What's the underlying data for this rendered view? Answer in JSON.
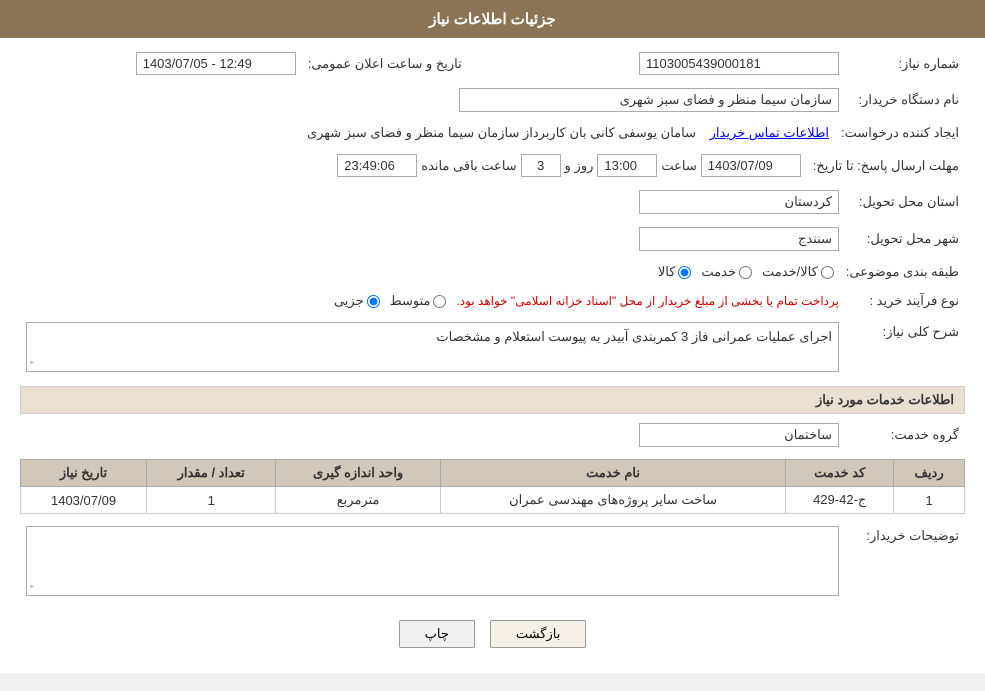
{
  "header": {
    "title": "جزئیات اطلاعات نیاز"
  },
  "need_info": {
    "section_title": "جزئیات اطلاعات نیاز",
    "need_number_label": "شماره نیاز:",
    "need_number_value": "1103005439000181",
    "buyer_org_label": "نام دستگاه خریدار:",
    "buyer_org_value": "سازمان سیما  منظر و فضای سبز شهری",
    "creator_label": "ایجاد کننده درخواست:",
    "creator_value": "سازمان سیما  منظر و فضای سبز شهری",
    "creator_link": "اطلاعات تماس خریدار",
    "creator_system": "سامان یوسفی کانی بان کاربرداز سازمان سیما  منظر و فضای سبز شهری",
    "deadline_label": "مهلت ارسال پاسخ: تا تاریخ:",
    "date_value": "1403/07/09",
    "time_label": "ساعت",
    "time_value": "13:00",
    "day_label": "روز و",
    "days_value": "3",
    "remaining_time_label": "ساعت باقی مانده",
    "remaining_time_value": "23:49:06",
    "announcement_label": "تاریخ و ساعت اعلان عمومی:",
    "announcement_value": "1403/07/05 - 12:49",
    "province_label": "استان محل تحویل:",
    "province_value": "کردستان",
    "city_label": "شهر محل تحویل:",
    "city_value": "سنندج",
    "category_label": "طبقه بندی موضوعی:",
    "category_options": [
      "کالا",
      "خدمت",
      "کالا/خدمت"
    ],
    "category_selected": "کالا",
    "purchase_type_label": "نوع فرآیند خرید :",
    "purchase_type_options": [
      "جزیی",
      "متوسط"
    ],
    "purchase_type_note": "پرداخت تمام یا بخشی از مبلغ خریدار از محل \"اسناد خزانه اسلامی\" خواهد بود.",
    "description_section_label": "شرح کلی نیاز:",
    "description_value": "اجرای عملیات عمرانی فاز 3 کمربندی آبیدر به پیوست استعلام و مشخصات",
    "services_section_title": "اطلاعات خدمات مورد نیاز",
    "service_group_label": "گروه خدمت:",
    "service_group_value": "ساختمان",
    "table_headers": [
      "ردیف",
      "کد خدمت",
      "نام خدمت",
      "واحد اندازه گیری",
      "تعداد / مقدار",
      "تاریخ نیاز"
    ],
    "table_rows": [
      {
        "row": "1",
        "code": "ج-42-429",
        "name": "ساخت سایر پروژه‌های مهندسی عمران",
        "unit": "مترمربع",
        "quantity": "1",
        "date": "1403/07/09"
      }
    ],
    "buyer_notes_label": "توضیحات خریدار:",
    "buyer_notes_value": "",
    "buttons": {
      "print": "چاپ",
      "back": "بازگشت"
    }
  }
}
